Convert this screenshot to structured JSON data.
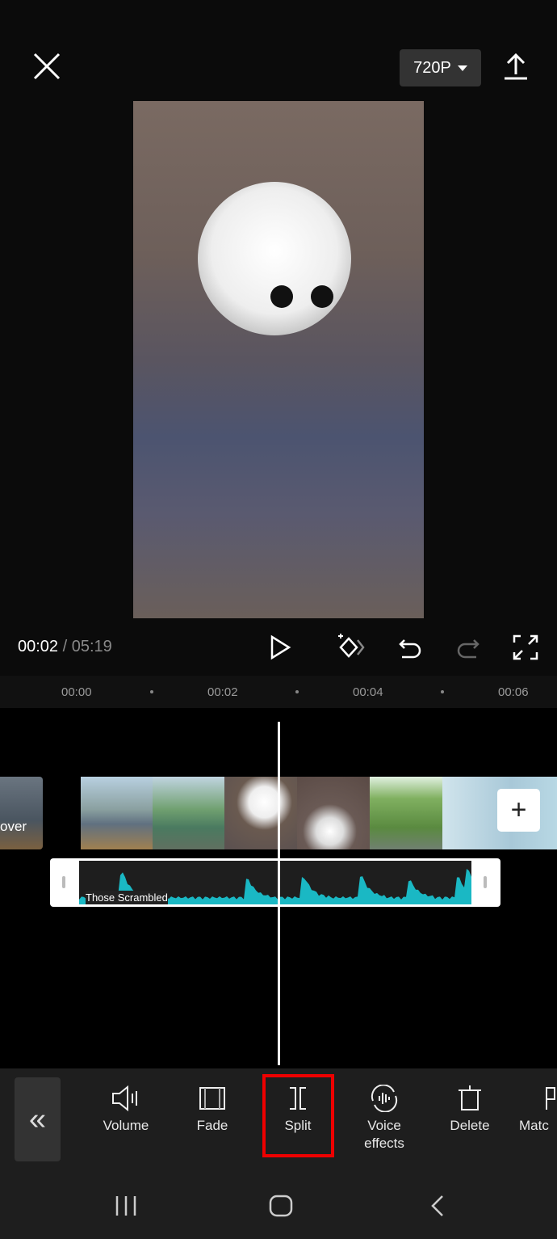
{
  "header": {
    "resolution": "720P",
    "icons": [
      "close-icon",
      "export-icon"
    ]
  },
  "player": {
    "current_time": "00:02",
    "total_time": "/ 05:19",
    "icons": [
      "play-icon",
      "keyframe-icon",
      "undo-icon",
      "redo-icon",
      "fullscreen-icon"
    ]
  },
  "ruler": [
    "00:00",
    "00:02",
    "00:04",
    "00:06"
  ],
  "timeline": {
    "cover_label": "over",
    "audio_title": "Those Scrambled",
    "accent": "#1ab8c4"
  },
  "toolbar": {
    "items": [
      {
        "label": "Volume"
      },
      {
        "label": "Fade"
      },
      {
        "label": "Split"
      },
      {
        "label": "Voice effects"
      },
      {
        "label": "Delete"
      },
      {
        "label": "Matc"
      }
    ],
    "highlight": "#e00000"
  }
}
